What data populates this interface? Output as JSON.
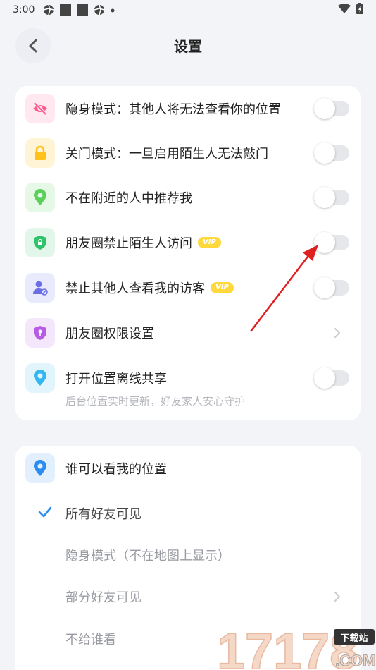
{
  "status_bar": {
    "time": "3:00"
  },
  "header": {
    "title": "设置"
  },
  "privacy": {
    "items": [
      {
        "label": "隐身模式：其他人将无法查看你的位置",
        "type": "toggle",
        "icon": "eye-off-icon",
        "color": "#ff5a8c",
        "bg": "#ffe8ef"
      },
      {
        "label": "关门模式：一旦启用陌生人无法敲门",
        "type": "toggle",
        "icon": "lock-icon",
        "color": "#ffc21a",
        "bg": "#fff5d6"
      },
      {
        "label": "不在附近的人中推荐我",
        "type": "toggle",
        "icon": "location-pin-icon",
        "color": "#5ccf5c",
        "bg": "#e6f8e6"
      },
      {
        "label": "朋友圈禁止陌生人访问",
        "type": "toggle",
        "vip": "VIP",
        "icon": "shield-lock-icon",
        "color": "#2fc36b",
        "bg": "#e2f7ea"
      },
      {
        "label": "禁止其他人查看我的访客",
        "type": "toggle",
        "vip": "VIP",
        "icon": "user-block-icon",
        "color": "#6a6fe8",
        "bg": "#e9eafc"
      },
      {
        "label": "朋友圈权限设置",
        "type": "link",
        "icon": "shield-key-icon",
        "color": "#b65ce6",
        "bg": "#f4e6fb"
      },
      {
        "label": "打开位置离线共享",
        "type": "toggle",
        "icon": "location-share-icon",
        "color": "#34b6f0",
        "bg": "#e2f4fc"
      }
    ],
    "offline_sub": "后台位置实时更新，好友家人安心守护"
  },
  "visibility": {
    "title": "谁可以看我的位置",
    "options": [
      {
        "label": "所有好友可见",
        "selected": true
      },
      {
        "label": "隐身模式（不在地图上显示）",
        "selected": false
      },
      {
        "label": "部分好友可见",
        "selected": false
      },
      {
        "label": "不给谁看",
        "selected": false
      }
    ]
  },
  "watermark": {
    "number": "17178",
    "tag": "下载站",
    "domain": ".COM"
  },
  "colors": {
    "accent": "#2a8cf0",
    "annotation_arrow": "#e0201f"
  }
}
